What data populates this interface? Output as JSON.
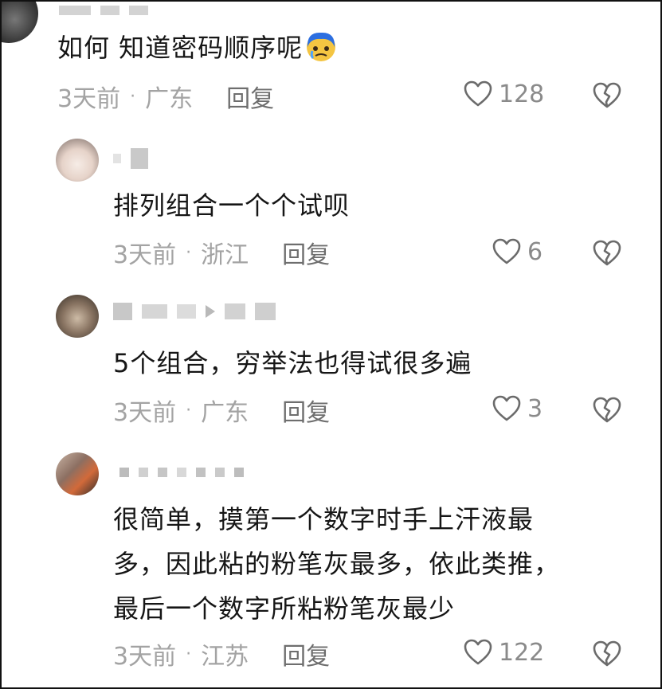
{
  "comments": [
    {
      "text": "如何 知道密码顺序呢",
      "time": "3天前",
      "location": "广东",
      "reply_label": "回复",
      "likes": "128"
    },
    {
      "text": "排列组合一个个试呗",
      "time": "3天前",
      "location": "浙江",
      "reply_label": "回复",
      "likes": "6"
    },
    {
      "text": "5个组合，穷举法也得试很多遍",
      "time": "3天前",
      "location": "广东",
      "reply_label": "回复",
      "likes": "3"
    },
    {
      "lines": [
        "很简单，摸第一个数字时手上汗液最",
        "多，因此粘的粉笔灰最多，依此类推，",
        "最后一个数字所粘粉笔灰最少"
      ],
      "time": "3天前",
      "location": "江苏",
      "reply_label": "回复",
      "likes": "122"
    }
  ],
  "icons": {
    "like": "heart-outline-icon",
    "dislike": "broken-heart-icon",
    "emoji": "crying-face-emoji"
  },
  "colors": {
    "text": "#161616",
    "meta": "#a3a3a3",
    "icon": "#6b6b6b"
  }
}
